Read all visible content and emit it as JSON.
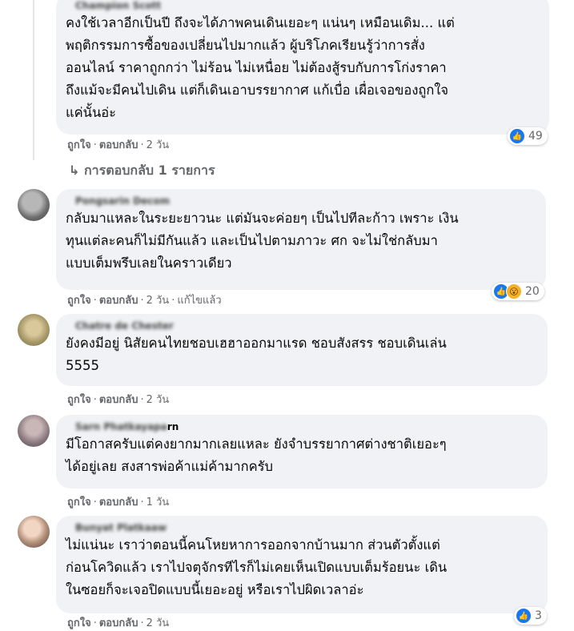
{
  "comments": [
    {
      "author": "Champion Scott",
      "lines": [
        "คงใช้เวลาอีกเป็นปี ถึงจะได้ภาพคนเดินเยอะๆ แน่นๆ เหมือนเดิม... แต่",
        "พฤติกรรมการซื้อของเปลี่ยนไปมากแล้ว ผู้บริโภคเรียนรู้ว่าการสั่ง",
        "ออนไลน์ ราคาถูกกว่า ไม่ร้อน ไม่เหนื่อย ไม่ต้องสู้รบกับการโก่งราคา",
        "ถึงแม้จะมีคนไปเดิน แต่ก็เดินเอาบรรยากาศ แก้เบื่อ เผื่อเจอของถูกใจ",
        "แค่นั้นอ่ะ"
      ],
      "like": "ถูกใจ",
      "reply": "ตอบกลับ",
      "time": "2 วัน",
      "reaction_count": "49"
    },
    {
      "author": "Pongsarin Decom",
      "lines": [
        "กลับมาแหละในระยะยาวนะ แต่มันจะค่อยๆ เป็นไปทีละก้าว เพราะ เงิน",
        "ทุนแต่ละคนก็ไม่มีกันแล้ว และเป็นไปตามภาวะ ศก จะไม่ใช่กลับมา",
        "แบบเต็มพรึบเลยในคราวเดียว"
      ],
      "like": "ถูกใจ",
      "reply": "ตอบกลับ",
      "time": "2 วัน",
      "edited": "แก้ไขแล้ว",
      "reaction_count": "20"
    },
    {
      "author": "Chatre de Chester",
      "lines": [
        "ยังคงมีอยู่ นิสัยคนไทยชอบเฮฮาออกมาแรด ชอบสังสรร ชอบเดินเล่น",
        "5555"
      ],
      "like": "ถูกใจ",
      "reply": "ตอบกลับ",
      "time": "2 วัน"
    },
    {
      "author": "Sarn Phatkayapa",
      "author_tail": "rn",
      "lines": [
        "มีโอกาสครับแต่คงยากมากเลยแหละ ยังจำบรรยากาศต่างชาติเยอะๆ",
        "ได้อยู่เลย สงสารพ่อค้าแม่ค้ามากครับ"
      ],
      "like": "ถูกใจ",
      "reply": "ตอบกลับ",
      "time": "1 วัน"
    },
    {
      "author": "Bunyat Platkaaw",
      "lines": [
        "ไม่แน่นะ เราว่าตอนนี้คนโหยหาการออกจากบ้านมาก ส่วนตัวตั้งแต่",
        "ก่อนโควิดแล้ว เราไปจตุจักรทีไรก็ไม่เคยเห็นเปิดแบบเต็มร้อยนะ เดิน",
        "ในซอยก็จะเจอปิดแบบนี้เยอะอยู่ หรือเราไปผิดเวลาอ่ะ"
      ],
      "like": "ถูกใจ",
      "reply": "ตอบกลับ",
      "time": "2 วัน",
      "reaction_count": "3"
    }
  ],
  "replies_link": "↳ การตอบกลับ 1 รายการ",
  "colors": {
    "like_blue": "#1877f2",
    "bubble": "#f0f2f5",
    "meta": "#65676b"
  }
}
